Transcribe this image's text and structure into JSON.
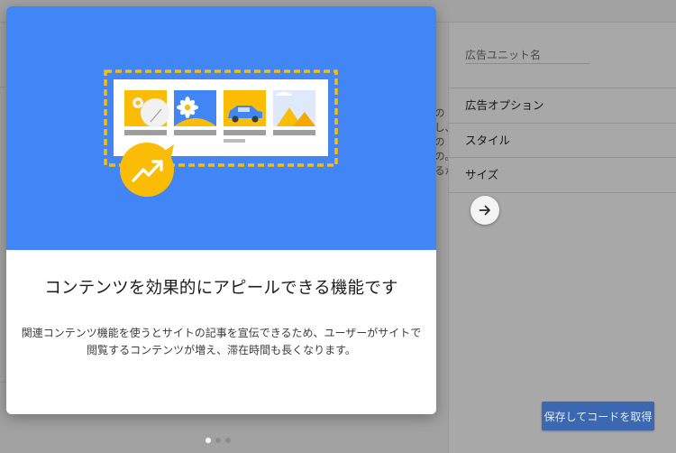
{
  "modal": {
    "title": "コンテンツを効果的にアピールできる機能です",
    "description": "関連コンテンツ機能を使うとサイトの記事を宣伝できるため、ユーザーがサイトで閲覧するコンテンツが増え、滞在時間も長くなります。",
    "hero_color": "#4285f4",
    "accent_color": "#fbbc05",
    "illustration": {
      "thumbnails": [
        "map-pin-thumbnail",
        "flower-thumbnail",
        "car-thumbnail",
        "pyramids-thumbnail"
      ],
      "badge_icon": "trending-up-icon"
    }
  },
  "pagination": {
    "total": 3,
    "active": 0
  },
  "right_panel": {
    "ad_unit_name_label": "広告ユニット名",
    "sections": [
      "広告オプション",
      "スタイル",
      "サイズ"
    ],
    "next_icon": "arrow-right-icon"
  },
  "background_peek": [
    "の",
    "し、",
    "の",
    "の。",
    "るが"
  ],
  "footer": {
    "save_label": "保存してコードを取得",
    "button_color": "#3b68b0"
  }
}
